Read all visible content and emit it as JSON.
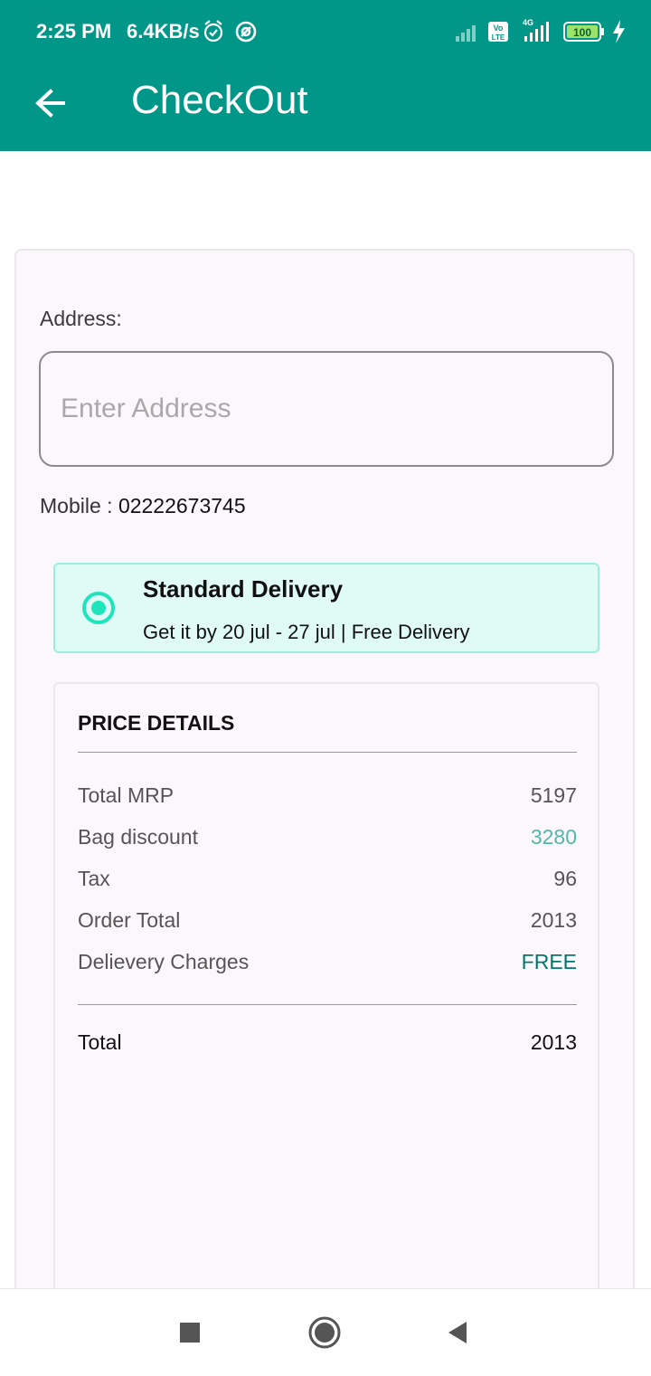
{
  "status_bar": {
    "time": "2:25 PM",
    "net_speed": "6.4KB/s",
    "battery": "100",
    "network": "4G",
    "volte": "VoLTE"
  },
  "app_bar": {
    "title": "CheckOut",
    "back_icon": "arrow-left-icon"
  },
  "address": {
    "label": "Address:",
    "placeholder": "Enter Address",
    "value": ""
  },
  "mobile": {
    "label": "Mobile :",
    "value": "02222673745"
  },
  "delivery": {
    "title": "Standard Delivery",
    "subtitle": "Get it by 20 jul - 27 jul | Free Delivery",
    "selected": true
  },
  "price_details": {
    "title": "PRICE DETAILS",
    "rows": [
      {
        "label": "Total MRP",
        "value": "5197"
      },
      {
        "label": "Bag discount",
        "value": "3280"
      },
      {
        "label": "Tax",
        "value": "96"
      },
      {
        "label": "Order Total",
        "value": "2013"
      },
      {
        "label": "Delievery Charges",
        "value": "FREE"
      }
    ],
    "total": {
      "label": "Total",
      "value": "2013"
    }
  },
  "colors": {
    "primary": "#009788",
    "radio_accent": "#1de4bb",
    "delivery_bg": "#e0faf6",
    "discount": "#4fb9aa",
    "free": "#00796b"
  }
}
